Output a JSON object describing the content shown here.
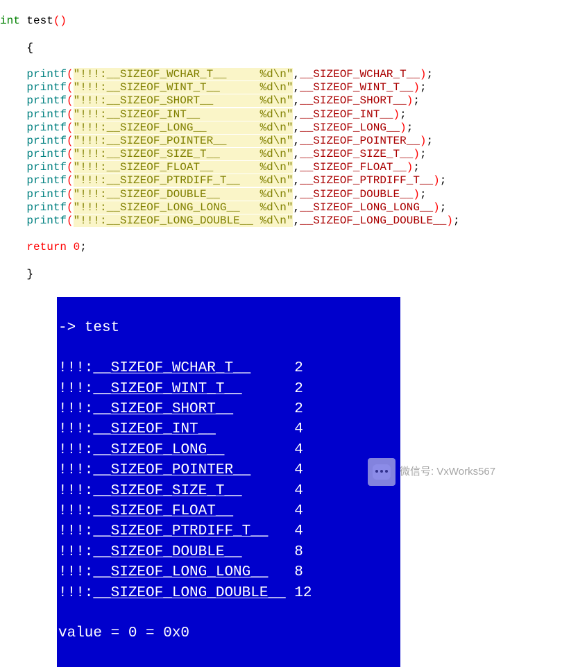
{
  "code": {
    "return_type": "int",
    "fn_name": "test",
    "open_brace": "{",
    "close_brace": "}",
    "return_kw": "return",
    "return_val": "0",
    "semicolon": ";",
    "call_name": "printf",
    "lines": [
      {
        "str": "\"!!!:__SIZEOF_WCHAR_T__     %d\\n\"",
        "arg": "__SIZEOF_WCHAR_T__"
      },
      {
        "str": "\"!!!:__SIZEOF_WINT_T__      %d\\n\"",
        "arg": "__SIZEOF_WINT_T__"
      },
      {
        "str": "\"!!!:__SIZEOF_SHORT__       %d\\n\"",
        "arg": "__SIZEOF_SHORT__"
      },
      {
        "str": "\"!!!:__SIZEOF_INT__         %d\\n\"",
        "arg": "__SIZEOF_INT__"
      },
      {
        "str": "\"!!!:__SIZEOF_LONG__        %d\\n\"",
        "arg": "__SIZEOF_LONG__"
      },
      {
        "str": "\"!!!:__SIZEOF_POINTER__     %d\\n\"",
        "arg": "__SIZEOF_POINTER__"
      },
      {
        "str": "\"!!!:__SIZEOF_SIZE_T__      %d\\n\"",
        "arg": "__SIZEOF_SIZE_T__"
      },
      {
        "str": "\"!!!:__SIZEOF_FLOAT__       %d\\n\"",
        "arg": "__SIZEOF_FLOAT__"
      },
      {
        "str": "\"!!!:__SIZEOF_PTRDIFF_T__   %d\\n\"",
        "arg": "__SIZEOF_PTRDIFF_T__"
      },
      {
        "str": "\"!!!:__SIZEOF_DOUBLE__      %d\\n\"",
        "arg": "__SIZEOF_DOUBLE__"
      },
      {
        "str": "\"!!!:__SIZEOF_LONG_LONG__   %d\\n\"",
        "arg": "__SIZEOF_LONG_LONG__"
      },
      {
        "str": "\"!!!:__SIZEOF_LONG_DOUBLE__ %d\\n\"",
        "arg": "__SIZEOF_LONG_DOUBLE__"
      }
    ]
  },
  "terminal": {
    "prompt_arrow": "->",
    "command": "test",
    "rows": [
      {
        "prefix": "!!!:",
        "underline": "__SIZEOF_WCHAR_T__",
        "val": "2",
        "pad": 5
      },
      {
        "prefix": "!!!:",
        "underline": "__SIZEOF_WINT_T__",
        "val": "2",
        "pad": 6
      },
      {
        "prefix": "!!!:",
        "underline": "__SIZEOF_SHORT__",
        "val": "2",
        "pad": 7
      },
      {
        "prefix": "!!!:",
        "underline": "__SIZEOF_INT__",
        "val": "4",
        "pad": 9
      },
      {
        "prefix": "!!!:",
        "underline": "__SIZEOF_LONG__",
        "val": "4",
        "pad": 8
      },
      {
        "prefix": "!!!:",
        "underline": "__SIZEOF_POINTER__",
        "val": "4",
        "pad": 5
      },
      {
        "prefix": "!!!:",
        "underline": "__SIZEOF_SIZE_T__",
        "val": "4",
        "pad": 6
      },
      {
        "prefix": "!!!:",
        "underline": "__SIZEOF_FLOAT__",
        "val": "4",
        "pad": 7
      },
      {
        "prefix": "!!!:",
        "underline": "__SIZEOF_PTRDIFF_T__",
        "val": "4",
        "pad": 3
      },
      {
        "prefix": "!!!:",
        "underline": "__SIZEOF_DOUBLE__",
        "val": "8",
        "pad": 6
      },
      {
        "prefix": "!!!:",
        "underline": "__SIZEOF_LONG_LONG__",
        "val": "8",
        "pad": 3
      },
      {
        "prefix": "!!!:",
        "underline": "__SIZEOF_LONG_DOUBLE__",
        "val": "12",
        "pad": 1
      }
    ],
    "value_line": "value = 0 = 0x0"
  },
  "watermark": {
    "label": "微信号",
    "sep": ":",
    "value": "VxWorks567"
  }
}
